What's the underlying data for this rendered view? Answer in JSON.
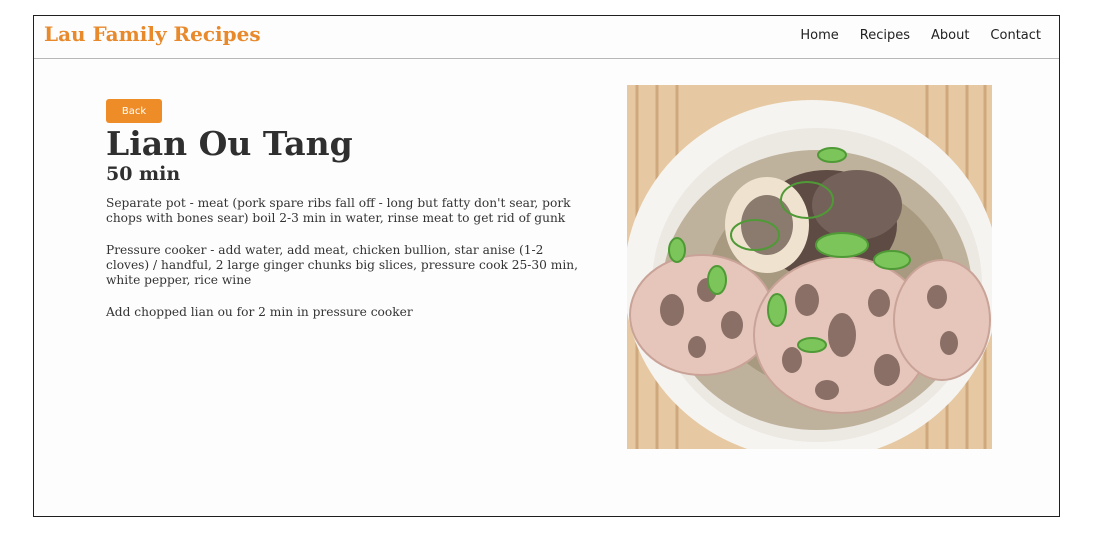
{
  "site": {
    "brand": "Lau Family Recipes"
  },
  "nav": {
    "items": [
      "Home",
      "Recipes",
      "About",
      "Contact"
    ]
  },
  "recipe": {
    "back_label": "Back",
    "title": "Lian Ou Tang",
    "time": "50 min",
    "steps": [
      "Separate pot - meat (pork spare ribs fall off - long but fatty don't sear, pork chops with bones sear) boil 2-3 min in water, rinse meat to get rid of gunk",
      "Pressure cooker - add water, add meat, chicken bullion, star anise (1-2 cloves) / handful, 2 large ginger chunks big slices, pressure cook 25-30 min, white pepper, rice wine",
      "Add chopped lian ou for 2 min in pressure cooker"
    ]
  },
  "colors": {
    "brand": "#e8892b",
    "button": "#ee8c28",
    "text": "#2f2f2f"
  },
  "icons": {
    "photo": "soup-bowl-photo"
  }
}
